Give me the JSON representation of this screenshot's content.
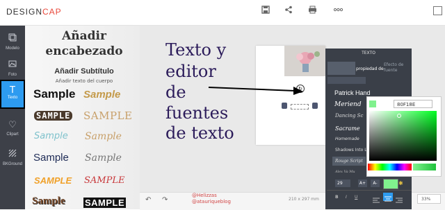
{
  "app": {
    "logo_left": "DESIGN",
    "logo_right": "CAP"
  },
  "toolbar": {
    "save_icon": "save-icon",
    "share_icon": "share-icon",
    "print_icon": "print-icon",
    "more_icon": "more-icon"
  },
  "sidebar": {
    "items": [
      {
        "label": "Modelo",
        "icon": "layout-icon"
      },
      {
        "label": "Foto",
        "icon": "photo-icon"
      },
      {
        "label": "Texto",
        "icon": "text-icon"
      },
      {
        "label": "Clipart",
        "icon": "heart-icon"
      },
      {
        "label": "BKGround",
        "icon": "background-icon"
      }
    ]
  },
  "panel": {
    "heading": "Añadir encabezado",
    "subtitle": "Añadir Subtítulo",
    "body_text": "Añadir texto del cuerpo",
    "samples": [
      "Sample",
      "Sample",
      "SAMPLE",
      "SAMPLE",
      "Sample",
      "Sample",
      "Sample",
      "Sample",
      "SAMPLE",
      "SAMPLE",
      "Sample",
      "SAMPLE"
    ]
  },
  "annotation": {
    "line1": "Texto y",
    "line2": "editor",
    "line3": "de",
    "line4": "fuentes",
    "line5": "de texto"
  },
  "bottom": {
    "credit1": "@Helizzas",
    "credit2": "@atauriqueblog",
    "size": "210 x 297 mm",
    "zoom": "33%"
  },
  "dialog": {
    "title": "TEXTO",
    "tab_property": "propiedad de",
    "tab_effect": "Efecto de fuente",
    "fonts": [
      "Patrick Hand",
      "Meriend",
      "Dancing Sc",
      "Sacrame",
      "Homemade",
      "Shadows Into L",
      "Rouge Script",
      "Alex Va Mu"
    ],
    "font_size": "29",
    "inc_label": "A+",
    "dec_label": "A-",
    "color_hex": "80F18E"
  },
  "colors": {
    "accent": "#2d9bf0",
    "sidebar": "#3d4048",
    "picked": "#80F18E"
  }
}
